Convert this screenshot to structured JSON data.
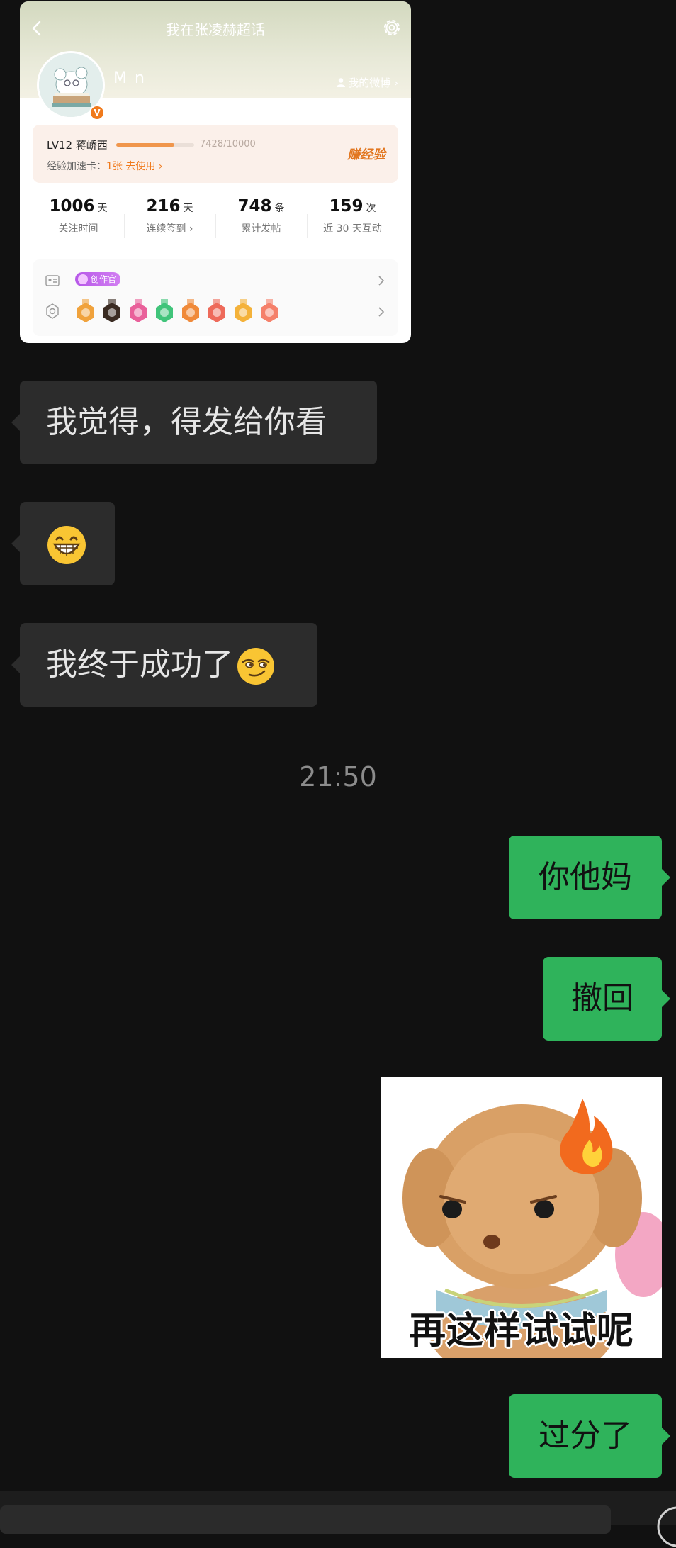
{
  "screenshot_card": {
    "title": "我在张凌赫超话",
    "user_name": "M   n",
    "verified_badge": "V",
    "my_weibo": "我的微博 ›",
    "level": {
      "label": "LV12 蒋峤西",
      "progress_text": "7428/10000",
      "progress_fraction": 0.7428,
      "exp_card_prefix": "经验加速卡：",
      "exp_card_count": "1张",
      "exp_card_action": "去使用 ›",
      "earn_button": "赚经验"
    },
    "stats": [
      {
        "value": "1006",
        "unit": "天",
        "label": "关注时间"
      },
      {
        "value": "216",
        "unit": "天",
        "label": "连续签到 ›"
      },
      {
        "value": "748",
        "unit": "条",
        "label": "累计发帖"
      },
      {
        "value": "159",
        "unit": "次",
        "label": "近 30 天互动"
      }
    ],
    "creator_tag": "创作官",
    "medal_colors": [
      "#f0a23c",
      "#3a2b22",
      "#e9609a",
      "#40c47a",
      "#f08a3a",
      "#ee6a5a",
      "#f4b23a",
      "#f5806a"
    ]
  },
  "messages": [
    {
      "side": "in",
      "text": "我觉得，得发给你看"
    },
    {
      "side": "in",
      "emoji": "grinning-face-icon"
    },
    {
      "side": "in",
      "text": "我终于成功了",
      "emoji": "smirking-face-icon"
    },
    {
      "timestamp": "21:50"
    },
    {
      "side": "out",
      "text": "你他妈"
    },
    {
      "side": "out",
      "text": "撤回"
    },
    {
      "side": "out",
      "sticker_caption": "再这样试试呢"
    },
    {
      "side": "out",
      "text": "过分了"
    }
  ],
  "colors": {
    "incoming_bubble": "#2c2c2c",
    "outgoing_bubble": "#2fb35b",
    "background": "#111111"
  }
}
